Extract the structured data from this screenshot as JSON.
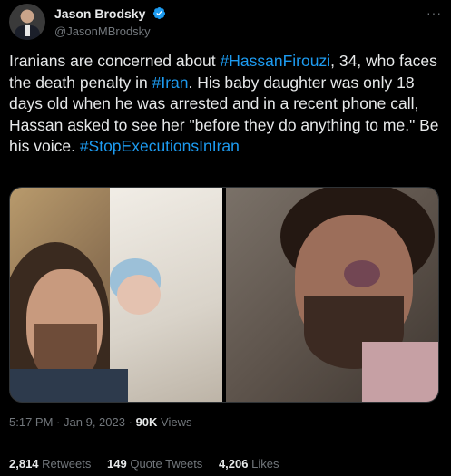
{
  "author": {
    "display_name": "Jason Brodsky",
    "handle": "@JasonMBrodsky",
    "verified": true,
    "avatar_icon": "avatar-photo"
  },
  "menu_icon": "more-options-icon",
  "tweet": {
    "segments": [
      {
        "text": "Iranians are concerned about ",
        "link": false
      },
      {
        "text": "#HassanFirouzi",
        "link": true
      },
      {
        "text": ", 34, who faces the death penalty in ",
        "link": false
      },
      {
        "text": "#Iran",
        "link": true
      },
      {
        "text": ". His baby daughter was only 18 days old when he was arrested and in a recent phone call, Hassan asked to see her \"before they do anything to me.\" Be his voice. ",
        "link": false
      },
      {
        "text": "#StopExecutionsInIran",
        "link": true
      }
    ]
  },
  "media": {
    "images": [
      "photo-man-with-baby",
      "photo-bruised-man"
    ]
  },
  "meta": {
    "time": "5:17 PM",
    "separator": "·",
    "date": "Jan 9, 2023",
    "views_count": "90K",
    "views_label": "Views"
  },
  "stats": {
    "retweets_count": "2,814",
    "retweets_label": "Retweets",
    "quotes_count": "149",
    "quotes_label": "Quote Tweets",
    "likes_count": "4,206",
    "likes_label": "Likes"
  },
  "colors": {
    "background": "#000000",
    "text": "#e7e9ea",
    "secondary": "#71767b",
    "link": "#1d9bf0",
    "divider": "#2f3336"
  }
}
